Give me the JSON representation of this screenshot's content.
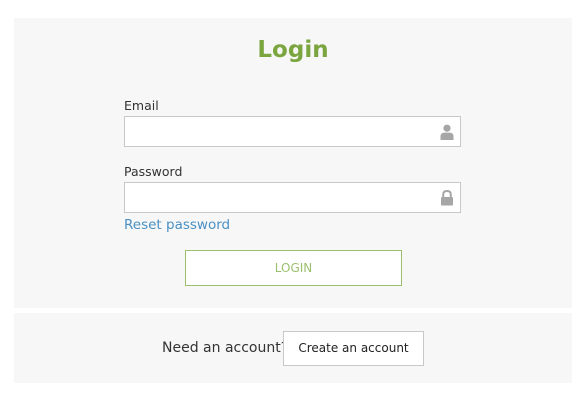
{
  "login": {
    "title": "Login",
    "email": {
      "label": "Email",
      "value": "",
      "placeholder": "",
      "icon": "user-icon"
    },
    "password": {
      "label": "Password",
      "value": "",
      "placeholder": "",
      "icon": "lock-icon"
    },
    "reset_link": "Reset password",
    "submit_label": "LOGIN"
  },
  "signup": {
    "prompt": "Need an account?",
    "create_label": "Create an account"
  },
  "colors": {
    "accent": "#7aa53f",
    "button_border": "#9cbf6f",
    "link": "#4a8fc2",
    "panel_bg": "#f7f7f7",
    "icon": "#a6a6a6"
  }
}
